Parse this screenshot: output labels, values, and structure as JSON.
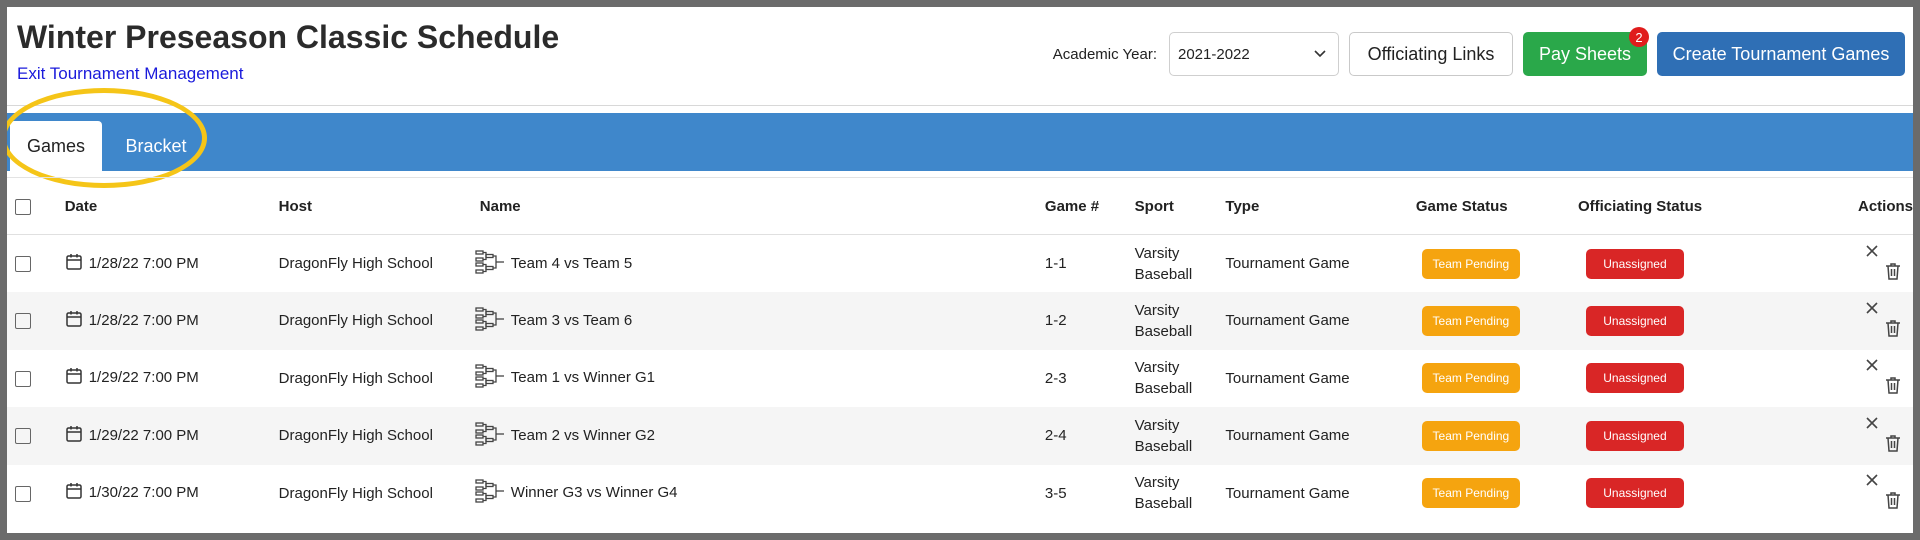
{
  "header": {
    "title": "Winter Preseason Classic Schedule",
    "exit_link": "Exit Tournament Management",
    "year_label": "Academic Year:",
    "year_value": "2021-2022",
    "officiating_links": "Officiating Links",
    "pay_sheets": "Pay Sheets",
    "pay_sheets_badge": "2",
    "create_games": "Create Tournament Games"
  },
  "tabs": [
    {
      "label": "Games",
      "active": true
    },
    {
      "label": "Bracket",
      "active": false
    }
  ],
  "columns": [
    "Date",
    "Host",
    "Name",
    "Game #",
    "Sport",
    "Type",
    "Game Status",
    "Officiating Status",
    "Actions"
  ],
  "rows": [
    {
      "date": "1/28/22 7:00 PM",
      "host": "DragonFly High School",
      "name": "Team 4 vs Team 5",
      "game": "1-1",
      "sport_line1": "Varsity",
      "sport_line2": "Baseball",
      "type": "Tournament Game",
      "game_status": "Team Pending",
      "officiating_status": "Unassigned"
    },
    {
      "date": "1/28/22 7:00 PM",
      "host": "DragonFly High School",
      "name": "Team 3 vs Team 6",
      "game": "1-2",
      "sport_line1": "Varsity",
      "sport_line2": "Baseball",
      "type": "Tournament Game",
      "game_status": "Team Pending",
      "officiating_status": "Unassigned"
    },
    {
      "date": "1/29/22 7:00 PM",
      "host": "DragonFly High School",
      "name": "Team 1 vs Winner G1",
      "game": "2-3",
      "sport_line1": "Varsity",
      "sport_line2": "Baseball",
      "type": "Tournament Game",
      "game_status": "Team Pending",
      "officiating_status": "Unassigned"
    },
    {
      "date": "1/29/22 7:00 PM",
      "host": "DragonFly High School",
      "name": "Team 2 vs Winner G2",
      "game": "2-4",
      "sport_line1": "Varsity",
      "sport_line2": "Baseball",
      "type": "Tournament Game",
      "game_status": "Team Pending",
      "officiating_status": "Unassigned"
    },
    {
      "date": "1/30/22 7:00 PM",
      "host": "DragonFly High School",
      "name": "Winner G3 vs Winner G4",
      "game": "3-5",
      "sport_line1": "Varsity",
      "sport_line2": "Baseball",
      "type": "Tournament Game",
      "game_status": "Team Pending",
      "officiating_status": "Unassigned"
    }
  ],
  "colors": {
    "tab_bar": "#3f87cb",
    "pay_sheets": "#2aa84a",
    "create_button": "#2f6fb5",
    "team_pending": "#f5a40f",
    "unassigned": "#d92626",
    "highlight_circle": "#f5c518"
  },
  "icons": {
    "date": "calendar-icon",
    "name": "bracket-icon",
    "remove": "close-icon",
    "delete": "trash-icon",
    "select": "chevron-down-icon"
  }
}
